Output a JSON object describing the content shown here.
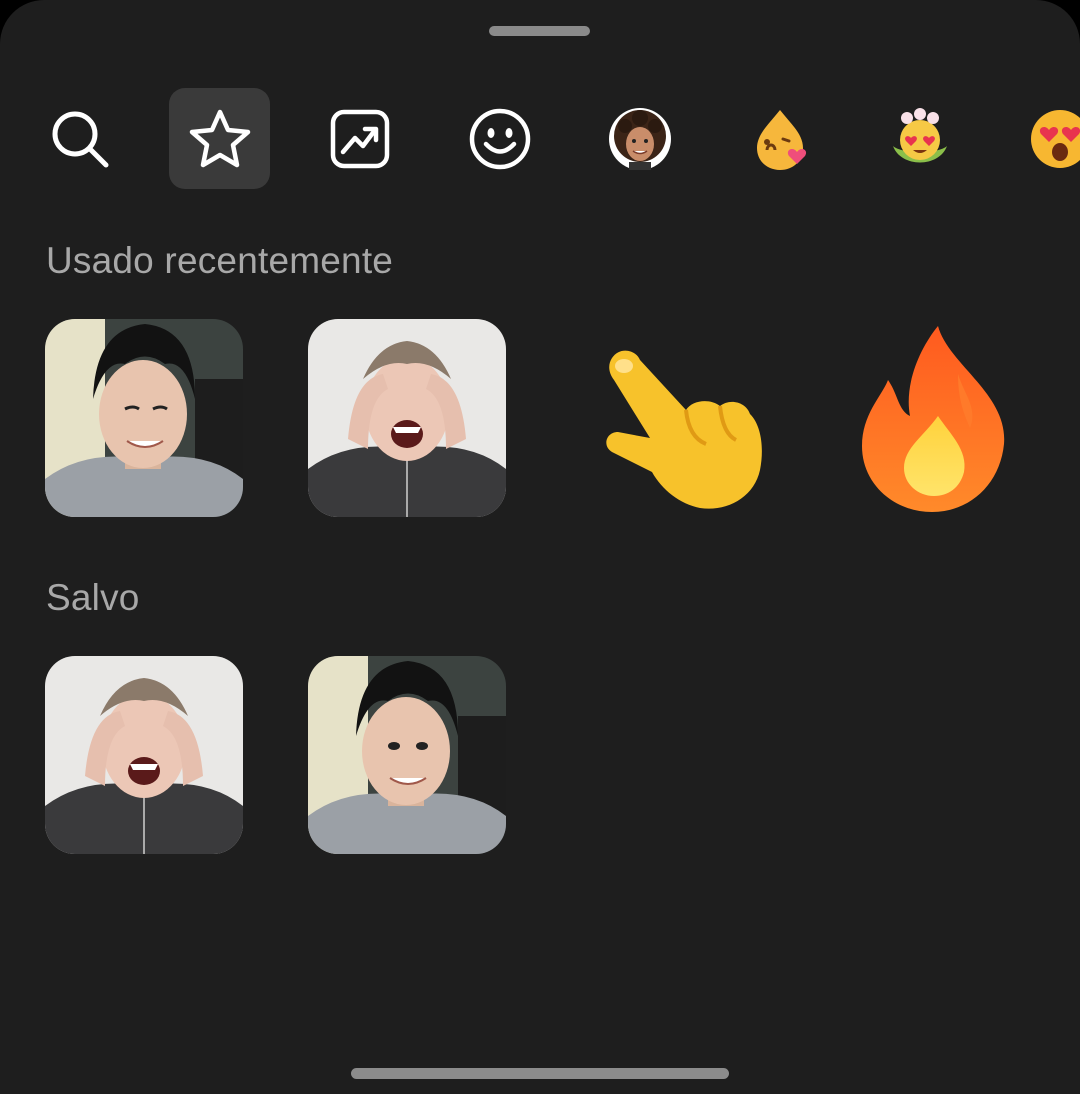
{
  "sheet": {
    "background": "#1e1e1e",
    "accent_selected": "#3a3a3a"
  },
  "toolbar": {
    "items": [
      {
        "icon": "search-icon",
        "selected": false
      },
      {
        "icon": "star-icon",
        "selected": true
      },
      {
        "icon": "trending-icon",
        "selected": false
      },
      {
        "icon": "smiley-icon",
        "selected": false
      },
      {
        "icon": "avatar-sticker-icon",
        "selected": false
      },
      {
        "icon": "kissing-drop-sticker-icon",
        "selected": false
      },
      {
        "icon": "heart-eyes-flower-sticker-icon",
        "selected": false
      },
      {
        "icon": "heart-eyes-emoji-icon",
        "selected": false
      }
    ]
  },
  "sections": {
    "recent": {
      "title": "Usado recentemente",
      "items": [
        "sticker-smiling-man",
        "sticker-laughing-man",
        "pointing-hand-emoji",
        "fire-emoji"
      ]
    },
    "saved": {
      "title": "Salvo",
      "items": [
        "sticker-laughing-man",
        "sticker-smiling-man"
      ]
    }
  }
}
